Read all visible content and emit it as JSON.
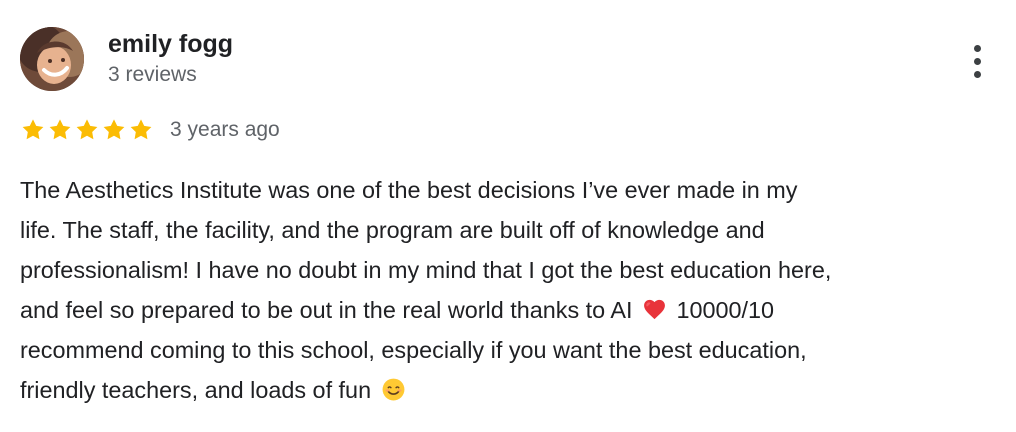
{
  "reviewer": {
    "name": "emily fogg",
    "review_count": "3 reviews"
  },
  "review": {
    "rating": 5,
    "rating_max": 5,
    "date": "3 years ago",
    "lines": [
      "The Aesthetics Institute was one of the best decisions I’ve ever made in my",
      "life. The staff, the facility, and the program are built off of knowledge and",
      "professionalism! I have no doubt in my mind that I got the best education here,",
      "and feel so prepared to be out in the real world thanks to AI",
      "10000/10",
      "recommend coming to this school, especially if you want the best education,",
      "friendly teachers, and loads of fun"
    ]
  },
  "icons": {
    "star": "star-icon",
    "more": "more-vert-icon",
    "heart": "heart-emoji",
    "smile": "smiling-face-emoji"
  },
  "colors": {
    "star": "#fbbc04",
    "text": "#202124",
    "secondary_text": "#5f6368",
    "heart": "#e8333a",
    "smile": "#ffc933"
  }
}
